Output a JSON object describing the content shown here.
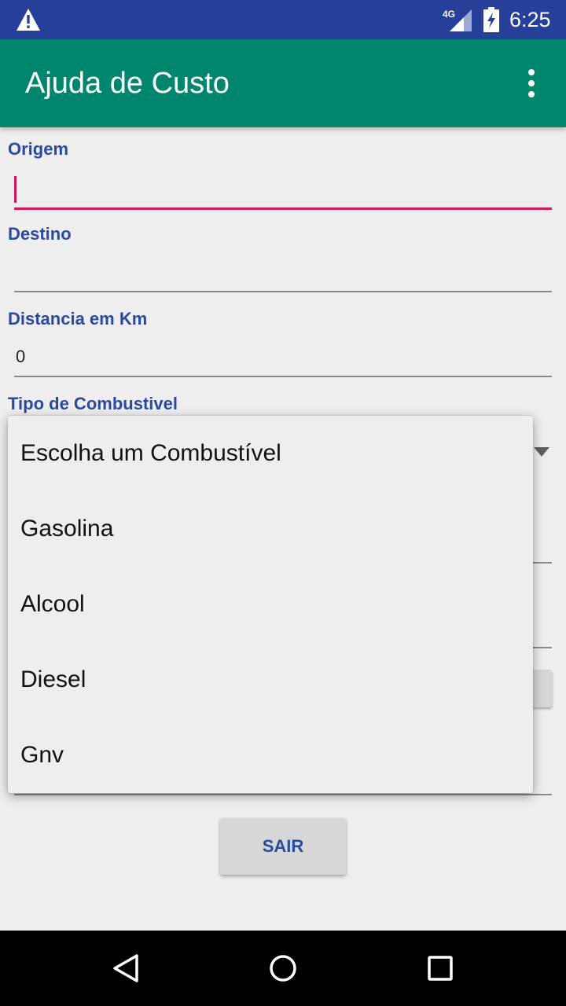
{
  "status_bar": {
    "network": "4G",
    "time": "6:25",
    "icons": [
      "warning-icon",
      "signal-icon",
      "battery-charging-icon"
    ]
  },
  "app_bar": {
    "title": "Ajuda de Custo",
    "menu_icon": "overflow-menu-icon"
  },
  "form": {
    "origem": {
      "label": "Origem",
      "value": ""
    },
    "destino": {
      "label": "Destino",
      "value": ""
    },
    "distancia": {
      "label": "Distancia em Km",
      "value": "0"
    },
    "combustivel": {
      "label": "Tipo de Combustivel"
    }
  },
  "dropdown": {
    "options": [
      "Escolha um Combustível",
      "Gasolina",
      "Alcool",
      "Diesel",
      "Gnv"
    ]
  },
  "buttons": {
    "exit_label": "SAIR"
  },
  "nav_bar": {
    "icons": [
      "back-icon",
      "home-icon",
      "recents-icon"
    ]
  },
  "colors": {
    "status_bar": "#26409a",
    "app_bar": "#00856f",
    "label": "#2a49a3",
    "focus_accent": "#d3175f"
  }
}
